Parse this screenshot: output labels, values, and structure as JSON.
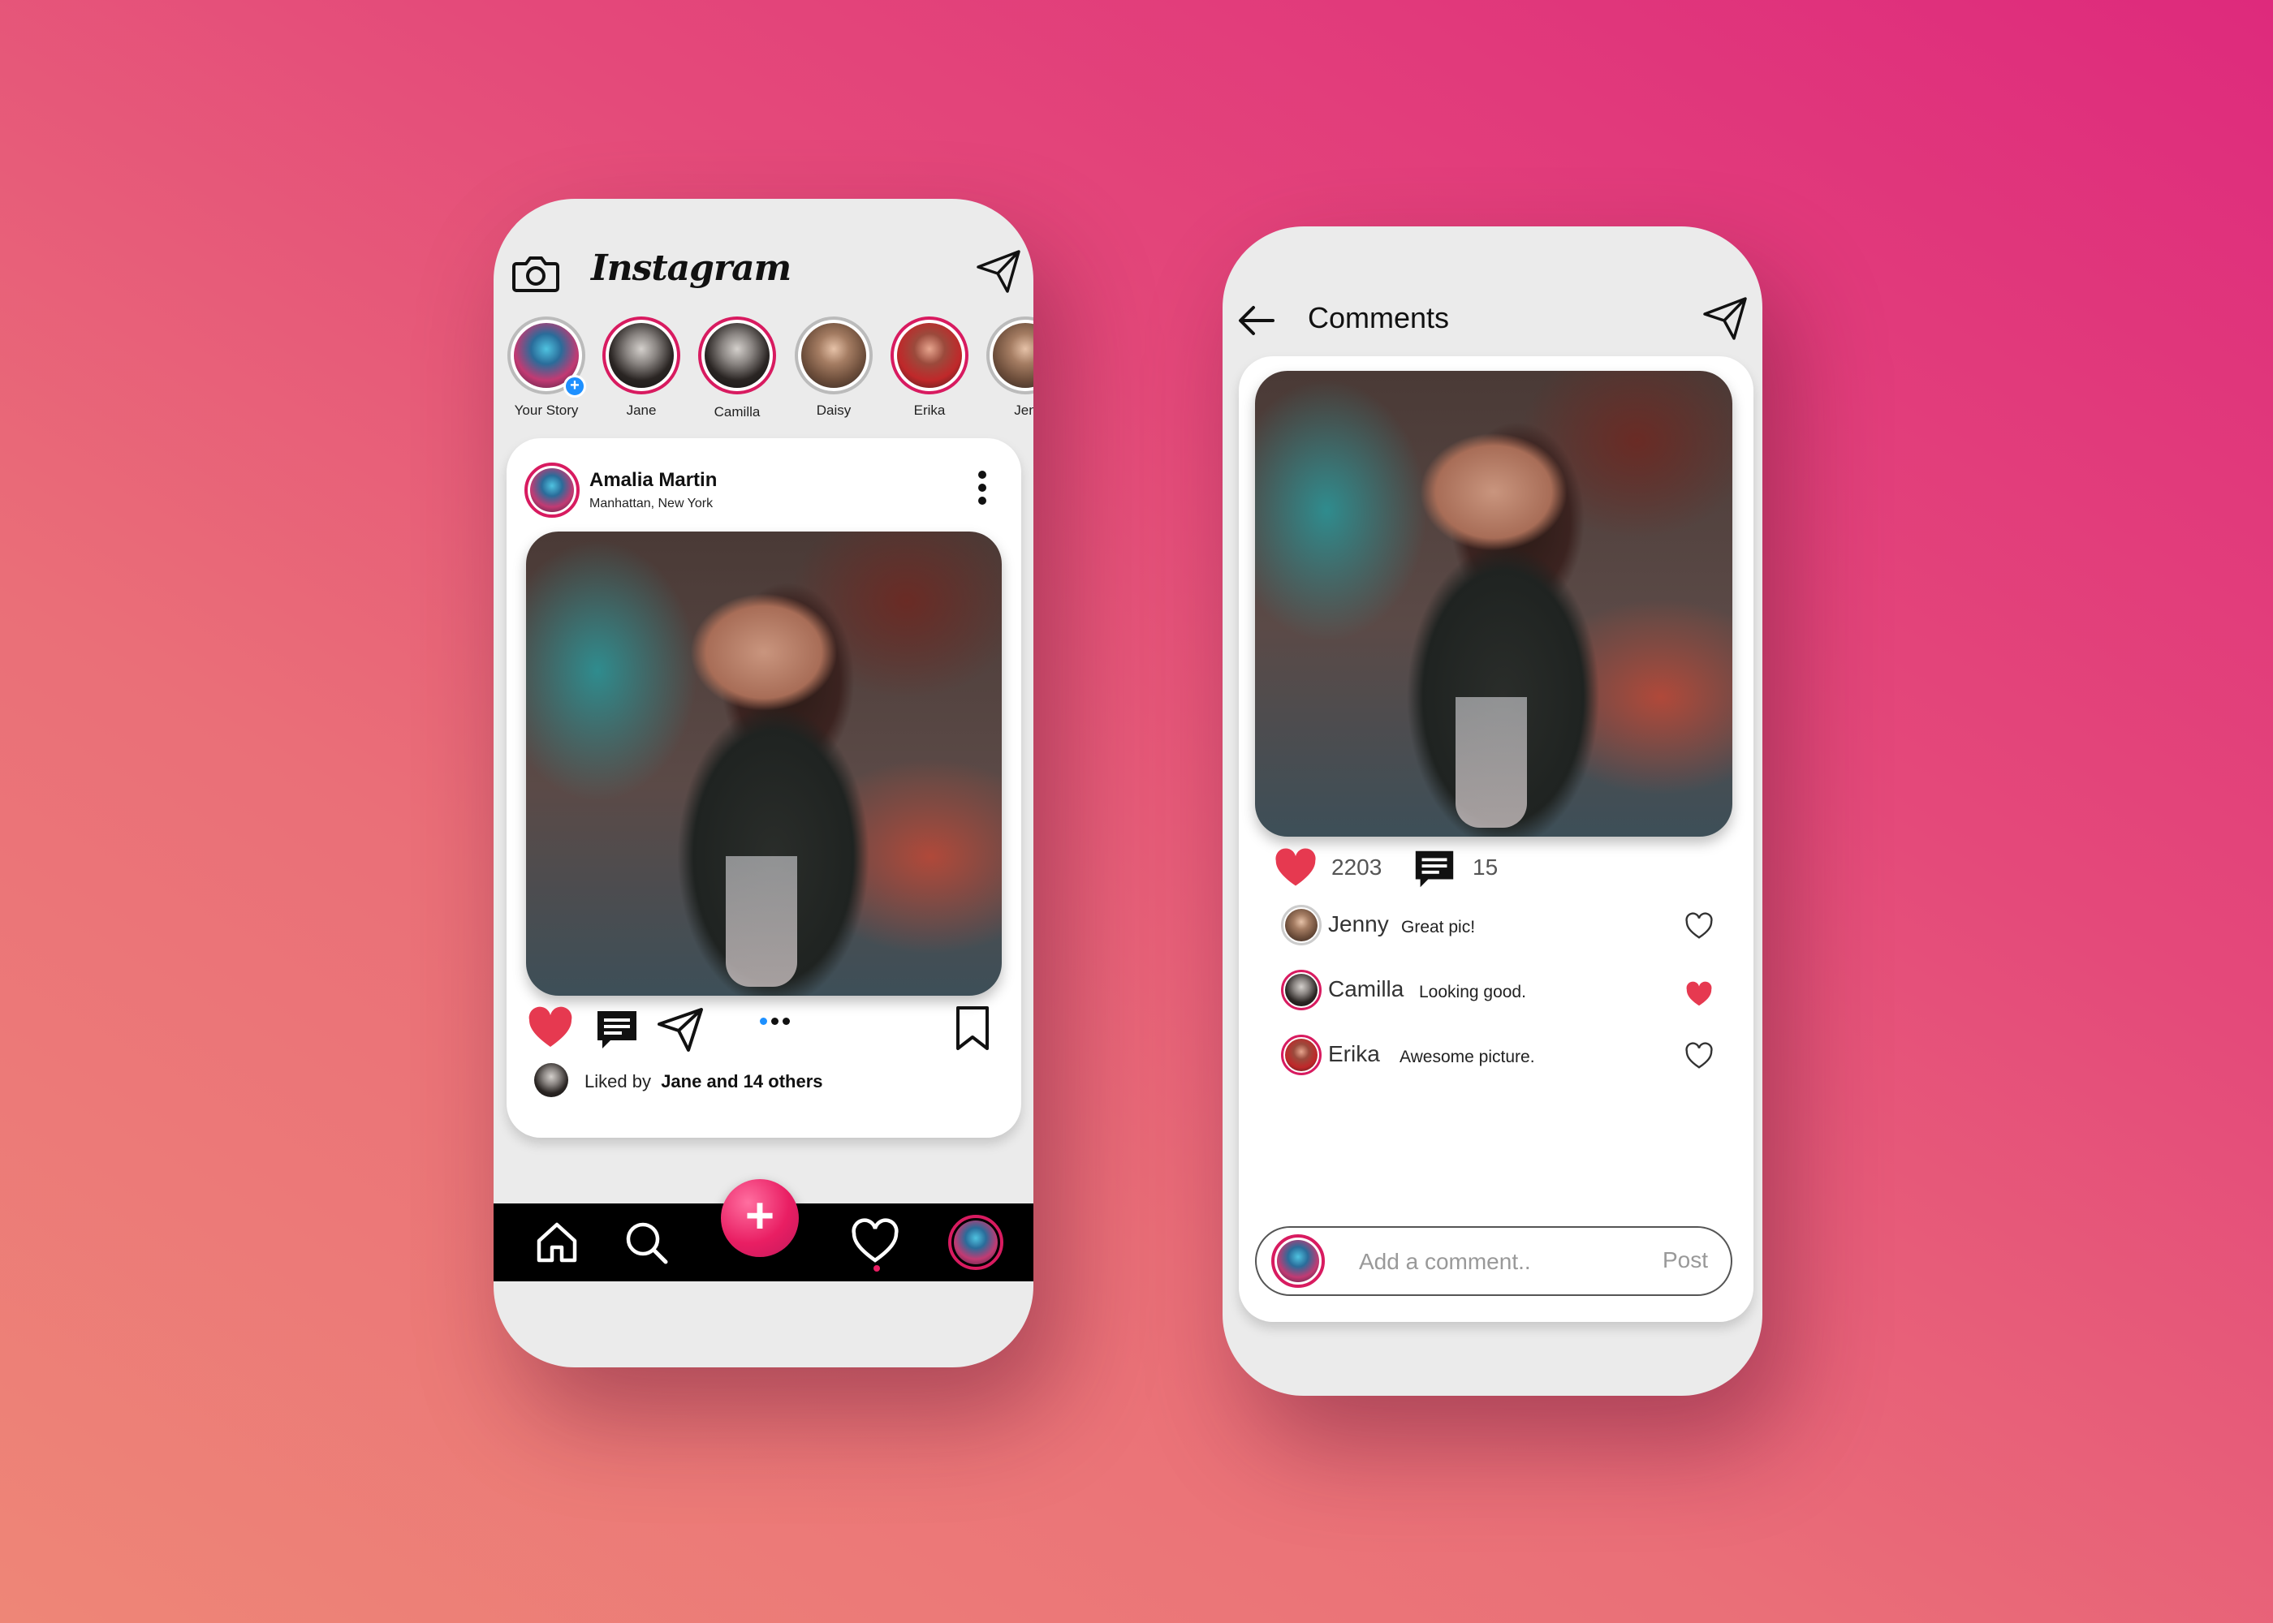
{
  "feed": {
    "brand": "Instagram",
    "stories": [
      {
        "label": "Your Story"
      },
      {
        "label": "Jane"
      },
      {
        "label": "Camilla"
      },
      {
        "label": "Daisy"
      },
      {
        "label": "Erika"
      },
      {
        "label": "Jen"
      }
    ],
    "post": {
      "author": "Amalia Martin",
      "location": "Manhattan, New York",
      "liked_prefix": "Liked by",
      "liked_names": "Jane and 14 others"
    },
    "nav": {
      "add_symbol": "+"
    }
  },
  "comments_screen": {
    "title": "Comments",
    "likes": "2203",
    "comment_count": "15",
    "comments": [
      {
        "name": "Jenny",
        "text": "Great pic!",
        "liked": false
      },
      {
        "name": "Camilla",
        "text": "Looking good.",
        "liked": true
      },
      {
        "name": "Erika",
        "text": "Awesome picture.",
        "liked": false
      }
    ],
    "composer": {
      "placeholder": "Add a comment..",
      "post_label": "Post"
    }
  },
  "colors": {
    "accent": "#e91e63",
    "like_red": "#e63950",
    "story_ring": "#d81b60",
    "badge_blue": "#1e90ff"
  }
}
